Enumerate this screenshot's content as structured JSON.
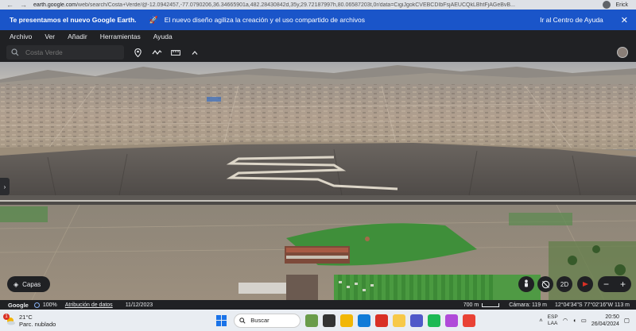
{
  "browser": {
    "url_host": "earth.google.com",
    "url_rest": "/web/search/Costa+Verde/@-12.0942457,-77.0790206,36.34665901a,482.28430842d,35y,29.72187997h,80.06587203t,0r/data=CigiJgokCVEBCDIbFsjAEUCQkLBhtFjAGeBvB...",
    "user": "Erick"
  },
  "banner": {
    "title": "Te presentamos el nuevo Google Earth.",
    "message": "El nuevo diseño agiliza la creación y el uso compartido de archivos",
    "help_link": "Ir al Centro de Ayuda",
    "close": "✕"
  },
  "menu": [
    "Archivo",
    "Ver",
    "Añadir",
    "Herramientas",
    "Ayuda"
  ],
  "search": {
    "value": "",
    "placeholder": "Costa Verde"
  },
  "map": {
    "capas_label": "Capas",
    "view_2d": "2D"
  },
  "status": {
    "logo": "Google",
    "percent": "100%",
    "attribution": "Atribución de datos",
    "date": "11/12/2023",
    "scale": "700 m",
    "camera": "Cámara: 119 m",
    "coords": "12°04'34\"S 77°02'16\"W  113 m"
  },
  "taskbar": {
    "temp": "21°C",
    "weather": "Parc. nublado",
    "notif": "1",
    "search_label": "Buscar",
    "lang1": "ESP",
    "lang2": "LAA",
    "time": "20:50",
    "date": "26/04/2024"
  },
  "colors": {
    "banner": "#1a55c9",
    "toolbar": "#202124",
    "grass": "#3f8f3a"
  }
}
